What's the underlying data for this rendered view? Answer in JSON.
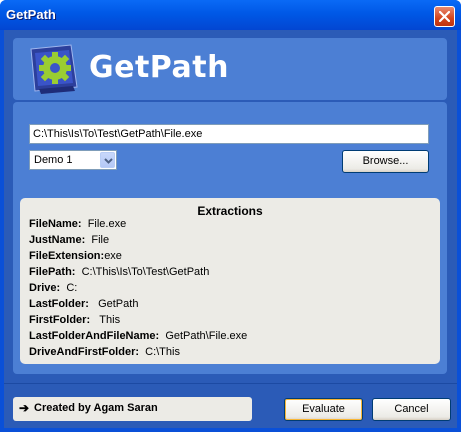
{
  "window": {
    "title": "GetPath"
  },
  "header": {
    "app_name": "GetPath",
    "logo": "gear-monitor-icon"
  },
  "path_input": {
    "value": "C:\\This\\Is\\To\\Test\\GetPath\\File.exe"
  },
  "demo_select": {
    "selected": "Demo 1"
  },
  "browse_label": "Browse...",
  "extractions": {
    "title": "Extractions",
    "rows": [
      {
        "key": "FileName:",
        "value": "File.exe"
      },
      {
        "key": "JustName:",
        "value": "File"
      },
      {
        "key": "FileExtension:",
        "value": "exe"
      },
      {
        "key": "FilePath:",
        "value": "C:\\This\\Is\\To\\Test\\GetPath"
      },
      {
        "key": "Drive:",
        "value": "C:"
      },
      {
        "key": "LastFolder:",
        "value": "GetPath"
      },
      {
        "key": "FirstFolder:",
        "value": "This"
      },
      {
        "key": "LastFolderAndFileName:",
        "value": "GetPath\\File.exe"
      },
      {
        "key": "DriveAndFirstFolder:",
        "value": "C:\\This"
      }
    ]
  },
  "footer": {
    "credit_arrow": "➔",
    "credit": "Created by Agam Saran",
    "evaluate_label": "Evaluate",
    "cancel_label": "Cancel"
  },
  "colors": {
    "titlebar": "#0058e6",
    "client": "#2b5bb7",
    "panel": "#4c7fd4",
    "surface": "#ecebe6",
    "close": "#d3441c"
  }
}
